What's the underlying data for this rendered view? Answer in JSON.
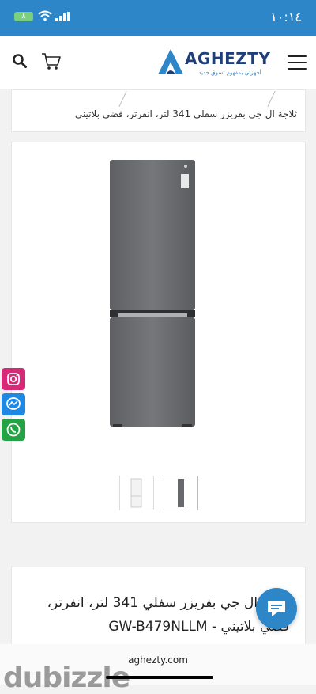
{
  "status": {
    "time": "١٠:١٤",
    "battery": "٨"
  },
  "header": {
    "brand": "AGHEZTY",
    "tagline": "أجهزتي بمفهوم تسوق جديد"
  },
  "breadcrumb": {
    "text": "ثلاجة ال جي بفريزر سفلي 341 لتر، انفرتر، فضي بلاتيني"
  },
  "product": {
    "title_line1": "ثلاجة ال جي بفريزر سفلي 341 لتر، انفرتر،",
    "title_line2": "فضي بلاتيني - GW-B479NLLM",
    "thumbnails": [
      "white-fridge",
      "silver-fridge"
    ]
  },
  "footer": {
    "url": "aghezty.com",
    "watermark": "dubizzle"
  },
  "colors": {
    "primary": "#2d86c8",
    "brand_dark": "#1f3f7b",
    "instagram": "#d62976",
    "messenger": "#1e88e5",
    "whatsapp": "#25a244"
  }
}
